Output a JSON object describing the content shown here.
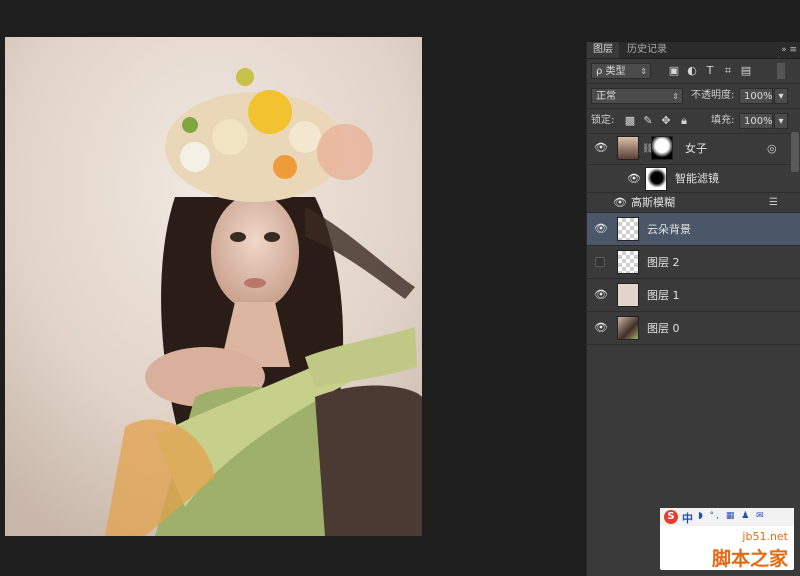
{
  "panel": {
    "tabs": [
      {
        "label": "图层",
        "active": true
      },
      {
        "label": "历史记录",
        "active": false
      }
    ],
    "menu_icon": "»  ≡",
    "filter": {
      "value": "ρ 类型",
      "icons": [
        "image-filter-icon",
        "adjustment-filter-icon",
        "type-filter-icon",
        "shape-filter-icon",
        "smart-object-filter-icon"
      ]
    },
    "blend_mode": "正常",
    "opacity_label": "不透明度:",
    "opacity_value": "100%",
    "lock_label": "锁定:",
    "fill_label": "填充:",
    "fill_value": "100%"
  },
  "layers": [
    {
      "name": "女子",
      "visible": true,
      "selected": false,
      "smart_object": true
    },
    {
      "name": "云朵背景",
      "visible": true,
      "selected": true
    },
    {
      "name": "图层 2",
      "visible": false,
      "selected": false
    },
    {
      "name": "图层 1",
      "visible": true,
      "selected": false
    },
    {
      "name": "图层 0",
      "visible": true,
      "selected": false
    }
  ],
  "smart_filters": {
    "label": "智能滤镜",
    "items": [
      {
        "name": "高斯模糊"
      }
    ]
  },
  "watermark": {
    "ime_s": "S",
    "ime_zh": "中",
    "ime_icons": "◗ °, ▦ ♟ ✉",
    "site": "jb51.net",
    "name": "脚本之家"
  },
  "colors": {
    "selection": "#4b5669",
    "panel_bg": "#3a3a3a",
    "workspace_bg": "#1e1e1e",
    "brand_orange": "#e36a12"
  }
}
